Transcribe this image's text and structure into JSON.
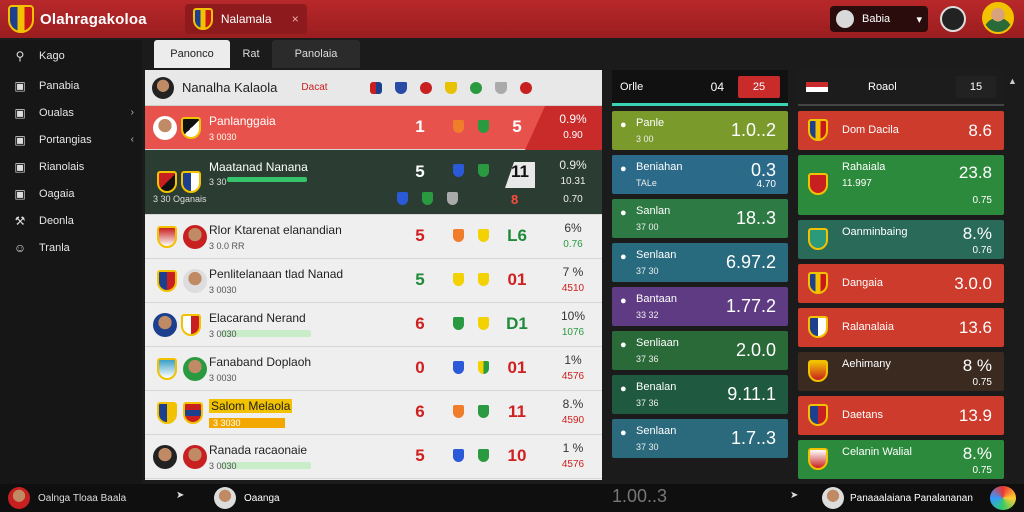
{
  "app": {
    "title": "Olahragakoloa"
  },
  "league": {
    "name": "Nalamala",
    "close": "×"
  },
  "user": {
    "name": "Babia",
    "chevron": "▾"
  },
  "sidebar": {
    "search": "Kago",
    "items": [
      {
        "label": "Panabia",
        "icon": "list-icon"
      },
      {
        "label": "Oualas",
        "icon": "list-icon",
        "arrow": "›"
      },
      {
        "label": "Portangias",
        "icon": "list-icon",
        "arrow": "‹"
      },
      {
        "label": "Rianolais",
        "icon": "list-icon"
      },
      {
        "label": "Oagaia",
        "icon": "list-icon"
      },
      {
        "label": "Deonla",
        "icon": "wrench-icon"
      },
      {
        "label": "Tranla",
        "icon": "team-icon"
      }
    ]
  },
  "tabs": [
    {
      "label": "Panonco"
    },
    {
      "label": "Rat"
    },
    {
      "label": "Panolaia"
    }
  ],
  "table": {
    "header": {
      "title": "Nanalha Kalaola",
      "sub": "Dacat"
    },
    "rows": [
      {
        "name": "Panlanggaia",
        "stat": "3 0030",
        "g1": "1",
        "g2": "5",
        "pct": "0.9%",
        "pct2": "0.90"
      },
      {
        "name": "Maatanad Nanana",
        "stat": "3 30",
        "sub": "3 30 Oganais",
        "g1": "5",
        "g2": "11",
        "g3": "8",
        "pct": "0.9%",
        "pct2": "10.31",
        "pct3": "0.70"
      },
      {
        "name": "Rlor Ktarenat elanandian",
        "stat": "3 0.0 RR",
        "g1": "5",
        "g2": "L6",
        "pct": "6%",
        "pct2": "0.76"
      },
      {
        "name": "Penlitelanaan tlad Nanad",
        "stat": "3 0030",
        "g1": "5",
        "g2": "01",
        "pct": "7 %",
        "pct2": "4510"
      },
      {
        "name": "Elacarand Nerand",
        "stat": "3 0030",
        "g1": "6",
        "g2": "D1",
        "pct": "10%",
        "pct2": "1076"
      },
      {
        "name": "Fanaband Doplaoh",
        "stat": "3 0030",
        "g1": "0",
        "g2": "01",
        "pct": "1%",
        "pct2": "4576"
      },
      {
        "name": "Salom Melaola",
        "stat": "3 3030",
        "g1": "6",
        "g2": "11",
        "pct": "8.%",
        "pct2": "4590"
      },
      {
        "name": "Ranada racaonaie",
        "stat": "3 0030",
        "g1": "5",
        "g2": "10",
        "pct": "1 %",
        "pct2": "4576"
      }
    ]
  },
  "panelA": {
    "header": {
      "title": "Orlle",
      "num": "04",
      "badge": "25"
    },
    "cards": [
      {
        "name": "Panle",
        "sub": "3 00",
        "value": "1.0..2",
        "color": "#7a9a2c"
      },
      {
        "name": "Beniahan",
        "sub": "TALe",
        "value": "0.3",
        "value2": "4.70",
        "color": "#2b6a88"
      },
      {
        "name": "Sanlan",
        "sub": "37 00",
        "value": "18..3",
        "color": "#2e7a44"
      },
      {
        "name": "Senlaan",
        "sub": "37 30",
        "value": "6.97.2",
        "color": "#286a7e"
      },
      {
        "name": "Bantaan",
        "sub": "33 32",
        "value": "1.77.2",
        "color": "#5e3b83"
      },
      {
        "name": "Senliaan",
        "sub": "37 36",
        "value": "2.0.0",
        "color": "#2a6a38"
      },
      {
        "name": "Benalan",
        "sub": "37 36",
        "value": "9.11.1",
        "color": "#1f5a40"
      },
      {
        "name": "Senlaan",
        "sub": "37 30",
        "value": "1.7..3",
        "color": "#2a6a7c"
      }
    ]
  },
  "panelB": {
    "header": {
      "title": "Roaol",
      "badge": "15"
    },
    "cards": [
      {
        "name": "Dom Dacila",
        "value": "8.6",
        "color": "#cc3b2b"
      },
      {
        "name": "Rahaiala",
        "sub": "11.997",
        "value": "23.8",
        "value2": "0.75",
        "color": "#2c8a3c"
      },
      {
        "name": "Oanminbaing",
        "value": "8.%",
        "value2": "0.76",
        "color": "#2a6a58"
      },
      {
        "name": "Dangaia",
        "value": "3.0.0",
        "color": "#cc3b2b"
      },
      {
        "name": "Ralanalaia",
        "value": "13.6",
        "color": "#cc3b2b"
      },
      {
        "name": "Aehimany",
        "value": "8 %",
        "value2": "0.75",
        "color": "#3a2a20"
      },
      {
        "name": "Daetans",
        "value": "13.9",
        "color": "#cc3b2b"
      },
      {
        "name": "Celanin Walial",
        "value": "8.%",
        "value2": "0.75",
        "color": "#2c8a3c"
      }
    ]
  },
  "bottom": {
    "left": "Oalnga Tloaa Baala",
    "mid": "Oaanga",
    "ghost": "1.00..3",
    "right": "Panaaalaiana Panalananan"
  }
}
